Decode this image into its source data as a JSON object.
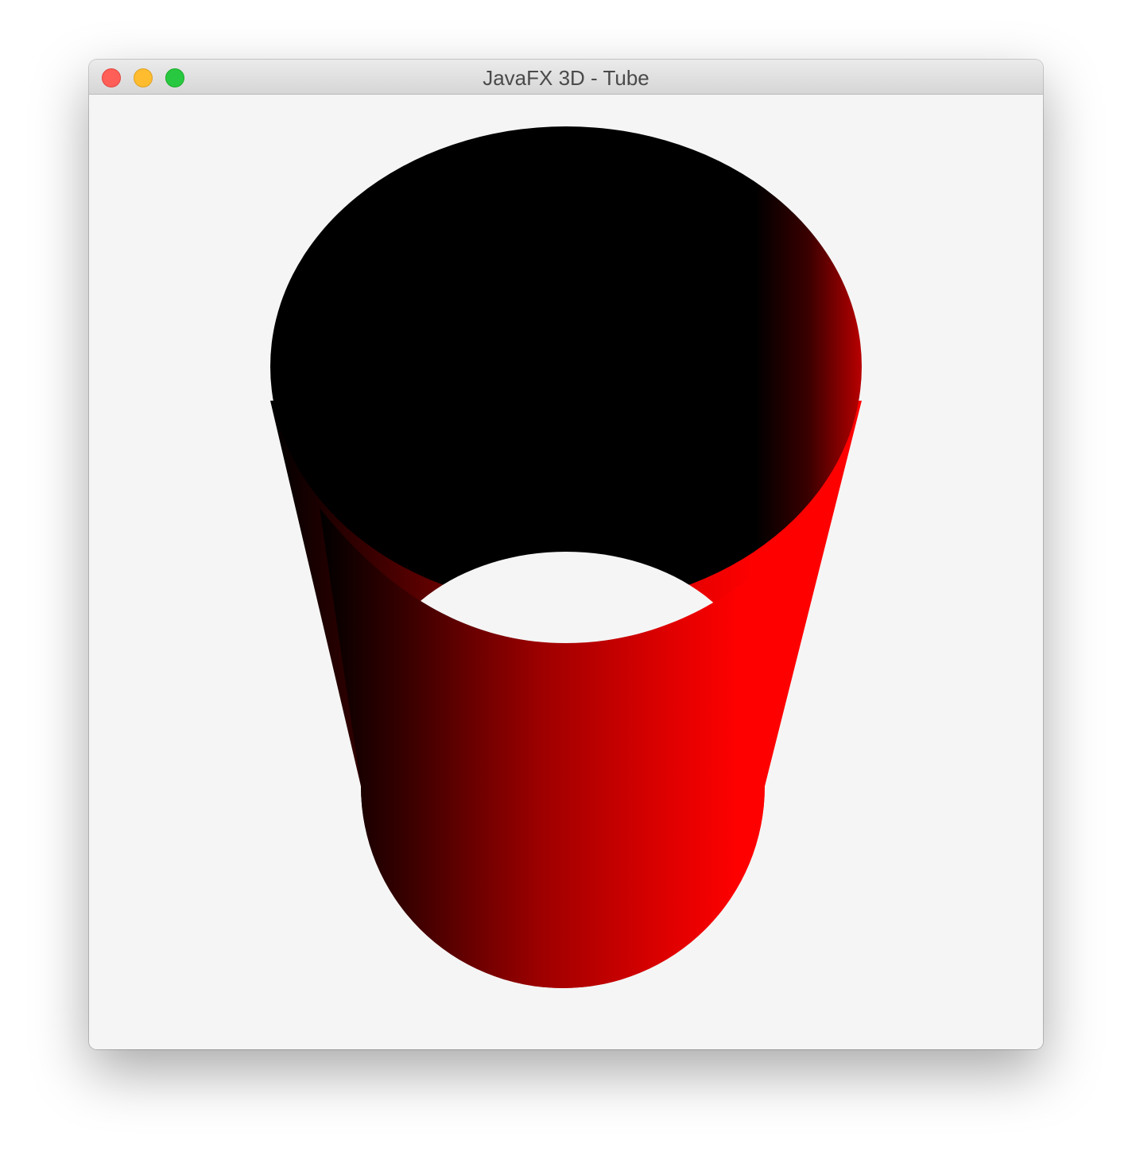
{
  "window": {
    "title": "JavaFX 3D - Tube",
    "controls": {
      "close_color": "#ff5f57",
      "minimize_color": "#febc2e",
      "zoom_color": "#28c840"
    }
  },
  "scene": {
    "object": "tube",
    "background_color": "#f5f5f5",
    "material_color": "#ff0000",
    "interior_color": "#000000"
  }
}
